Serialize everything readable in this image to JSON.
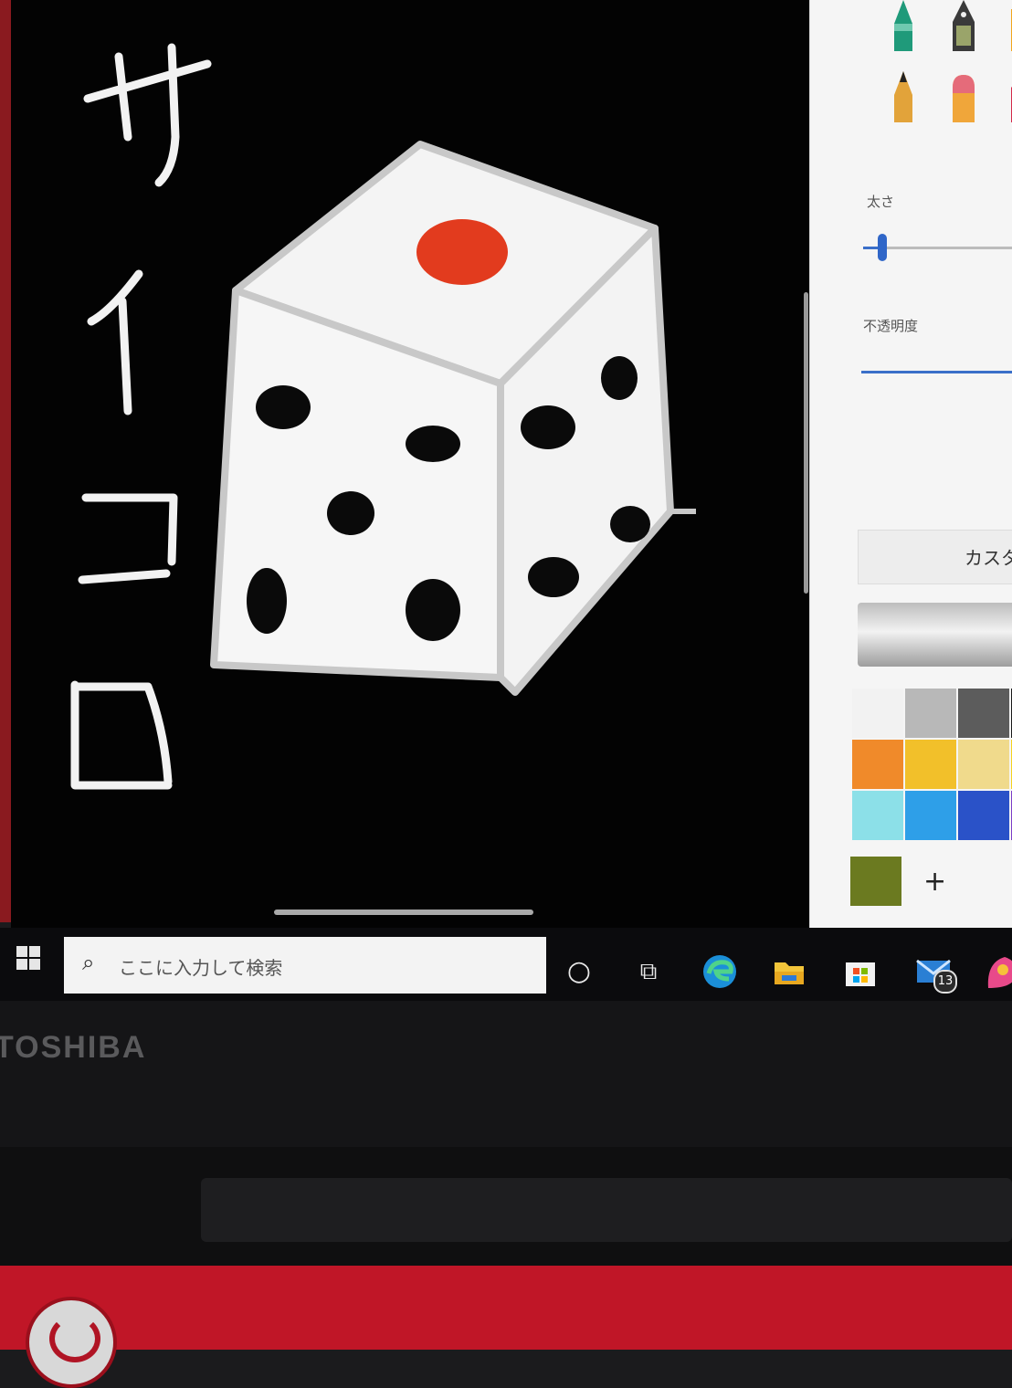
{
  "canvas": {
    "handwriting": [
      "サ",
      "イ",
      "コ",
      "ロ"
    ],
    "drawing": "dice"
  },
  "side_panel": {
    "thickness_label": "太さ",
    "opacity_label": "不透明度",
    "custom_label": "カスタム",
    "add_color": "+",
    "thickness_value": 0.05,
    "opacity_value": 1.0,
    "palette_row1": [
      "#f2f2f2",
      "#b8b8b8",
      "#5c5c5c",
      "#1a1a1a"
    ],
    "palette_row2": [
      "#f08a2a",
      "#f2c02a",
      "#f0da8c",
      "#f5d21e"
    ],
    "palette_row3": [
      "#8ce0e8",
      "#2e9fe8",
      "#2a52c8",
      "#7b3ec8"
    ],
    "selected_color": "#6b7a20"
  },
  "taskbar": {
    "search_placeholder": "ここに入力して検索",
    "search_icon": "⌕",
    "cortana_icon": "○",
    "taskview_icon": "⧉",
    "mail_badge": "13"
  },
  "device": {
    "brand": "TOSHIBA"
  },
  "colors": {
    "accent": "#2f66c8",
    "chassis_red": "#c01627"
  }
}
